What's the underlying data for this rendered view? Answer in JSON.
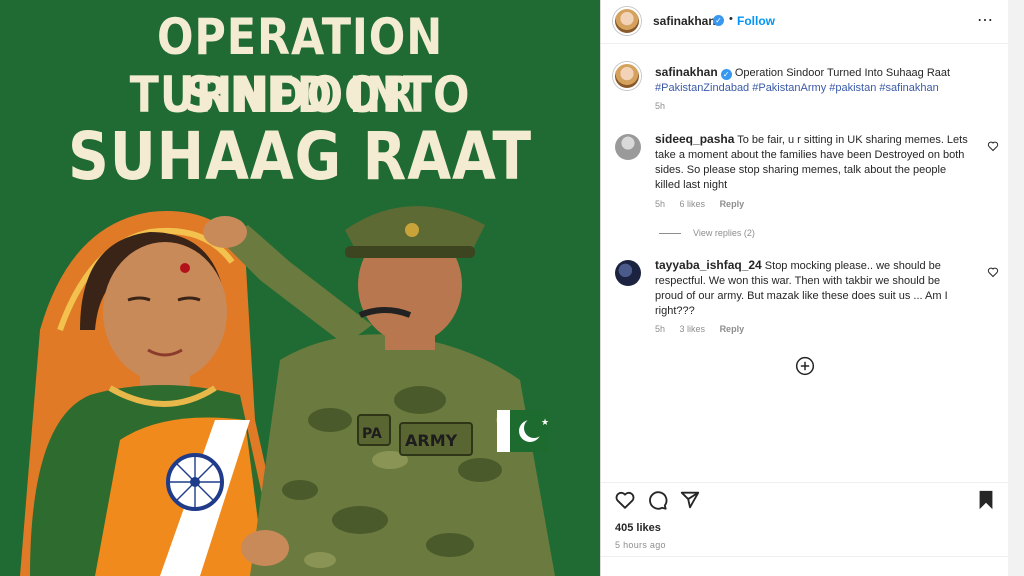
{
  "poster": {
    "line1": "OPERATION SINDOOR",
    "line2": "TURNED INTO",
    "line3": "SUHAAG RAAT",
    "uniform_patch_left": "PA",
    "uniform_patch_right": "ARMY"
  },
  "header": {
    "username": "safinakhan",
    "separator": "•",
    "follow_label": "Follow",
    "more_icon": "⋯"
  },
  "caption": {
    "username": "safinakhan",
    "text": "Operation Sindoor Turned Into Suhaag Raat",
    "hashtags": "#PakistanZindabad #PakistanArmy #pakistan #safinakhan",
    "time": "5h"
  },
  "comments": [
    {
      "username": "sideeq_pasha",
      "text": "To be fair, u r sitting in UK sharing memes. Lets take a moment about the families have been Destroyed on both sides. So please stop sharing memes, talk about the people killed last night",
      "time": "5h",
      "likes": "6 likes",
      "reply_label": "Reply",
      "view_replies": "View replies (2)"
    },
    {
      "username": "tayyaba_ishfaq_24",
      "text": "Stop mocking please.. we should be respectful. We won this war. Then with takbir we should be proud of our army. But mazak like these does suit us ... Am I right???",
      "time": "5h",
      "likes": "3 likes",
      "reply_label": "Reply"
    }
  ],
  "footer": {
    "likes": "405 likes",
    "time_ago": "5 hours ago"
  },
  "colors": {
    "poster_green": "#1f6b33",
    "accent_blue": "#0095f6",
    "verified_blue": "#3897f0",
    "hashtag_blue": "#3b5aa8"
  },
  "icons": [
    "more-options-icon",
    "verified-icon",
    "heart-icon",
    "comment-icon",
    "share-icon",
    "bookmark-icon",
    "add-circle-icon"
  ]
}
